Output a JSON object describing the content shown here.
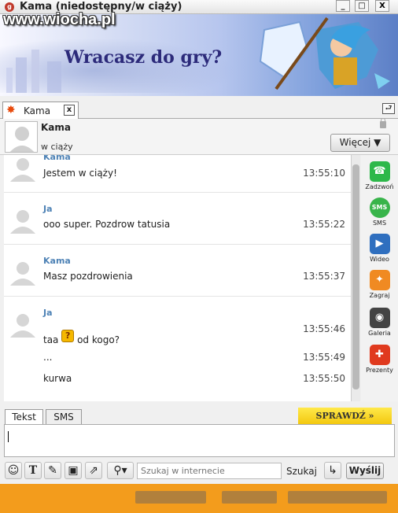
{
  "window": {
    "title": "Kama (niedostępny/w ciąży)",
    "watermark": "www.wiocha.pl",
    "controls": [
      "_",
      "□",
      "X"
    ]
  },
  "banner": {
    "headline": "Wracasz do gry?"
  },
  "tab": {
    "label": "Kama",
    "close": "x"
  },
  "contact": {
    "name": "Kama",
    "status": "w ciąży",
    "more_label": "Więcej ▼"
  },
  "messages": [
    {
      "sender": "Kama",
      "lines": [
        {
          "text": "Jestem w ciąży!",
          "time": "13:55:10"
        }
      ]
    },
    {
      "sender": "Ja",
      "lines": [
        {
          "text": "ooo super. Pozdrow tatusia",
          "time": "13:55:22"
        }
      ]
    },
    {
      "sender": "Kama",
      "lines": [
        {
          "text": "Masz pozdrowienia",
          "time": "13:55:37"
        }
      ]
    },
    {
      "sender": "Ja",
      "lines": [
        {
          "text_before": "taa",
          "text_after": "od kogo?",
          "emoticon": "confused-emoticon",
          "time": "13:55:46"
        },
        {
          "text": "...",
          "time": "13:55:49"
        },
        {
          "text": "kurwa",
          "time": "13:55:50"
        }
      ]
    }
  ],
  "apps": [
    {
      "label": "Zadzwoń",
      "icon": "phone-icon",
      "color": "#2db84a"
    },
    {
      "label": "SMS",
      "icon": "sms-icon",
      "color": "#38b44a"
    },
    {
      "label": "Wideo",
      "icon": "video-icon",
      "color": "#2f6fbf"
    },
    {
      "label": "Zagraj",
      "icon": "game-icon",
      "color": "#f08a22"
    },
    {
      "label": "Galeria",
      "icon": "camera-icon",
      "color": "#444444"
    },
    {
      "label": "Prezenty",
      "icon": "gift-icon",
      "color": "#e03a1e"
    }
  ],
  "input": {
    "tabs": [
      "Tekst",
      "SMS"
    ],
    "check_label": "SPRAWDŹ »",
    "search_placeholder": "Szukaj w internecie",
    "search_button": "Szukaj",
    "send_label": "Wyślij"
  },
  "colors": {
    "sender": "#4f83b6",
    "accent_orange": "#f39c1c",
    "check_yellow": "#ffe94a"
  }
}
